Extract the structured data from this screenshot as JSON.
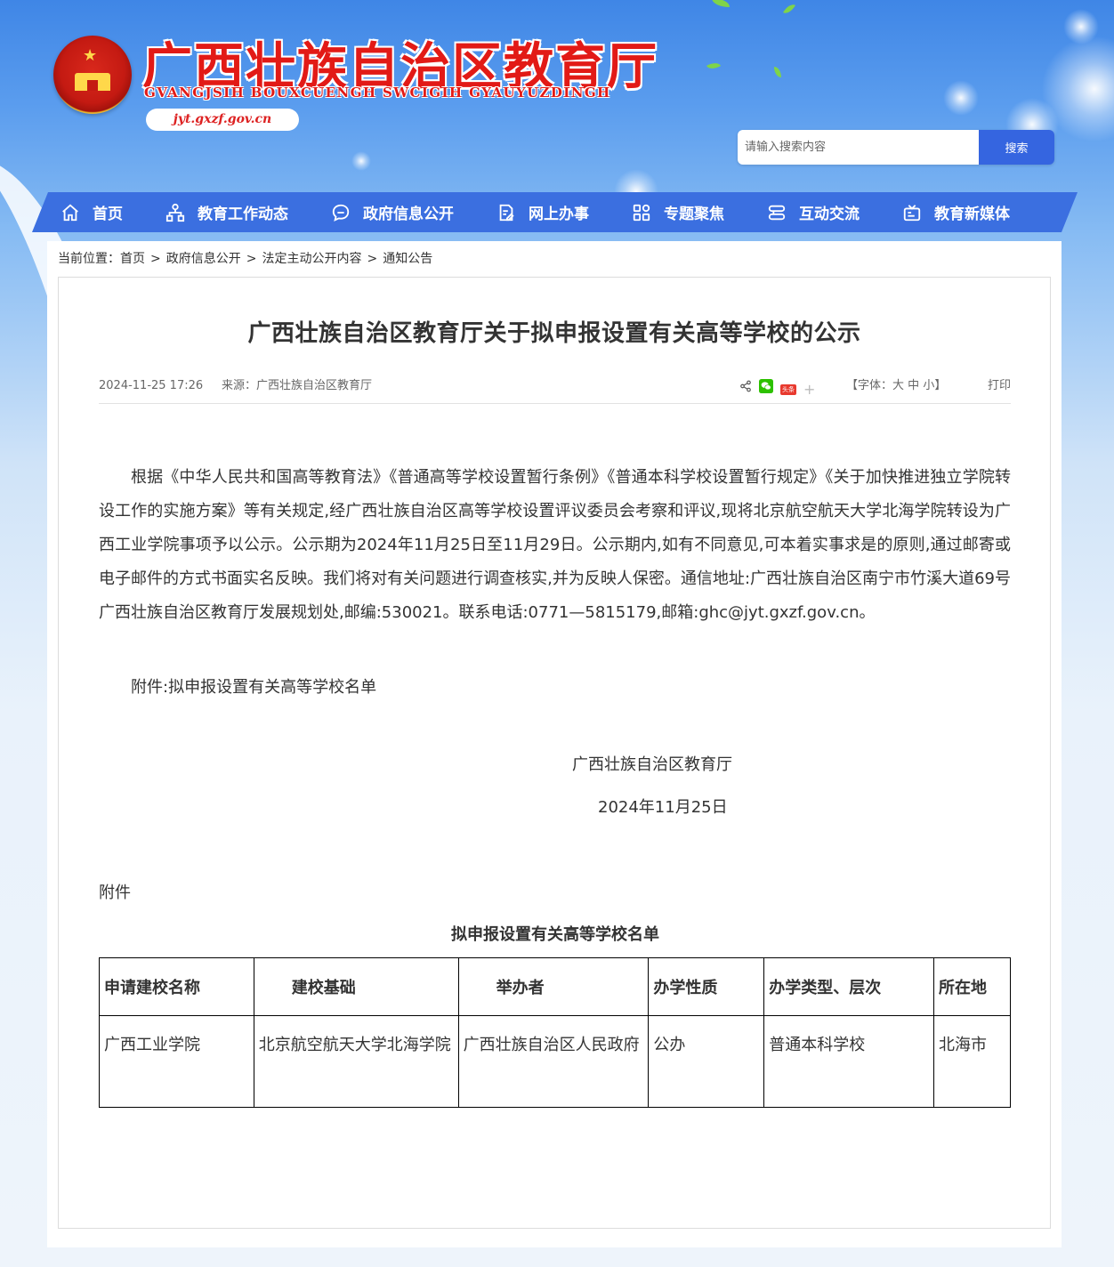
{
  "header": {
    "site_title": "广西壮族自治区教育厅",
    "site_subtitle": "GVANGJSIH BOUXCUENGH SWCIGIH GYAUYUZDINGH",
    "site_url": "jyt.gxzf.gov.cn"
  },
  "search": {
    "placeholder": "请输入搜索内容",
    "button_label": "搜索"
  },
  "nav": {
    "items": [
      {
        "label": "首页",
        "icon": "home-icon"
      },
      {
        "label": "教育工作动态",
        "icon": "org-chart-icon"
      },
      {
        "label": "政府信息公开",
        "icon": "chat-bubble-icon"
      },
      {
        "label": "网上办事",
        "icon": "document-edit-icon"
      },
      {
        "label": "专题聚焦",
        "icon": "grid-icon"
      },
      {
        "label": "互动交流",
        "icon": "interaction-icon"
      },
      {
        "label": "教育新媒体",
        "icon": "media-icon"
      }
    ]
  },
  "breadcrumb": {
    "prefix": "当前位置：",
    "items": [
      "首页",
      "政府信息公开",
      "法定主动公开内容",
      "通知公告"
    ],
    "separator": ">"
  },
  "article": {
    "title": "广西壮族自治区教育厅关于拟申报设置有关高等学校的公示",
    "date": "2024-11-25 17:26",
    "source": "来源：广西壮族自治区教育厅",
    "font_size_prefix": "【字体：",
    "font_sizes": [
      "大",
      "中",
      "小"
    ],
    "font_size_suffix": "】",
    "print_label": "打印",
    "share_badge": "头条",
    "share_plus": "+",
    "paragraph": "根据《中华人民共和国高等教育法》《普通高等学校设置暂行条例》《普通本科学校设置暂行规定》《关于加快推进独立学院转设工作的实施方案》等有关规定,经广西壮族自治区高等学校设置评议委员会考察和评议,现将北京航空航天大学北海学院转设为广西工业学院事项予以公示。公示期为2024年11月25日至11月29日。公示期内,如有不同意见,可本着实事求是的原则,通过邮寄或电子邮件的方式书面实名反映。我们将对有关问题进行调查核实,并为反映人保密。通信地址:广西壮族自治区南宁市竹溪大道69号广西壮族自治区教育厅发展规划处,邮编:530021。联系电话:0771—5815179,邮箱:ghc@jyt.gxzf.gov.cn。",
    "attachment_line": "附件:拟申报设置有关高等学校名单",
    "signature_org": "广西壮族自治区教育厅",
    "signature_date": "2024年11月25日",
    "attachment_label": "附件",
    "list_title": "拟申报设置有关高等学校名单"
  },
  "table": {
    "headers": [
      "申请建校名称",
      "建校基础",
      "举办者",
      "办学性质",
      "办学类型、层次",
      "所在地"
    ],
    "rows": [
      [
        "广西工业学院",
        "北京航空航天大学北海学院",
        "广西壮族自治区人民政府",
        "公办",
        "普通本科学校",
        "北海市"
      ]
    ]
  },
  "colors": {
    "nav_bg": "#3b6fe0",
    "title_red": "#e21a16",
    "search_button": "#3565e0"
  }
}
